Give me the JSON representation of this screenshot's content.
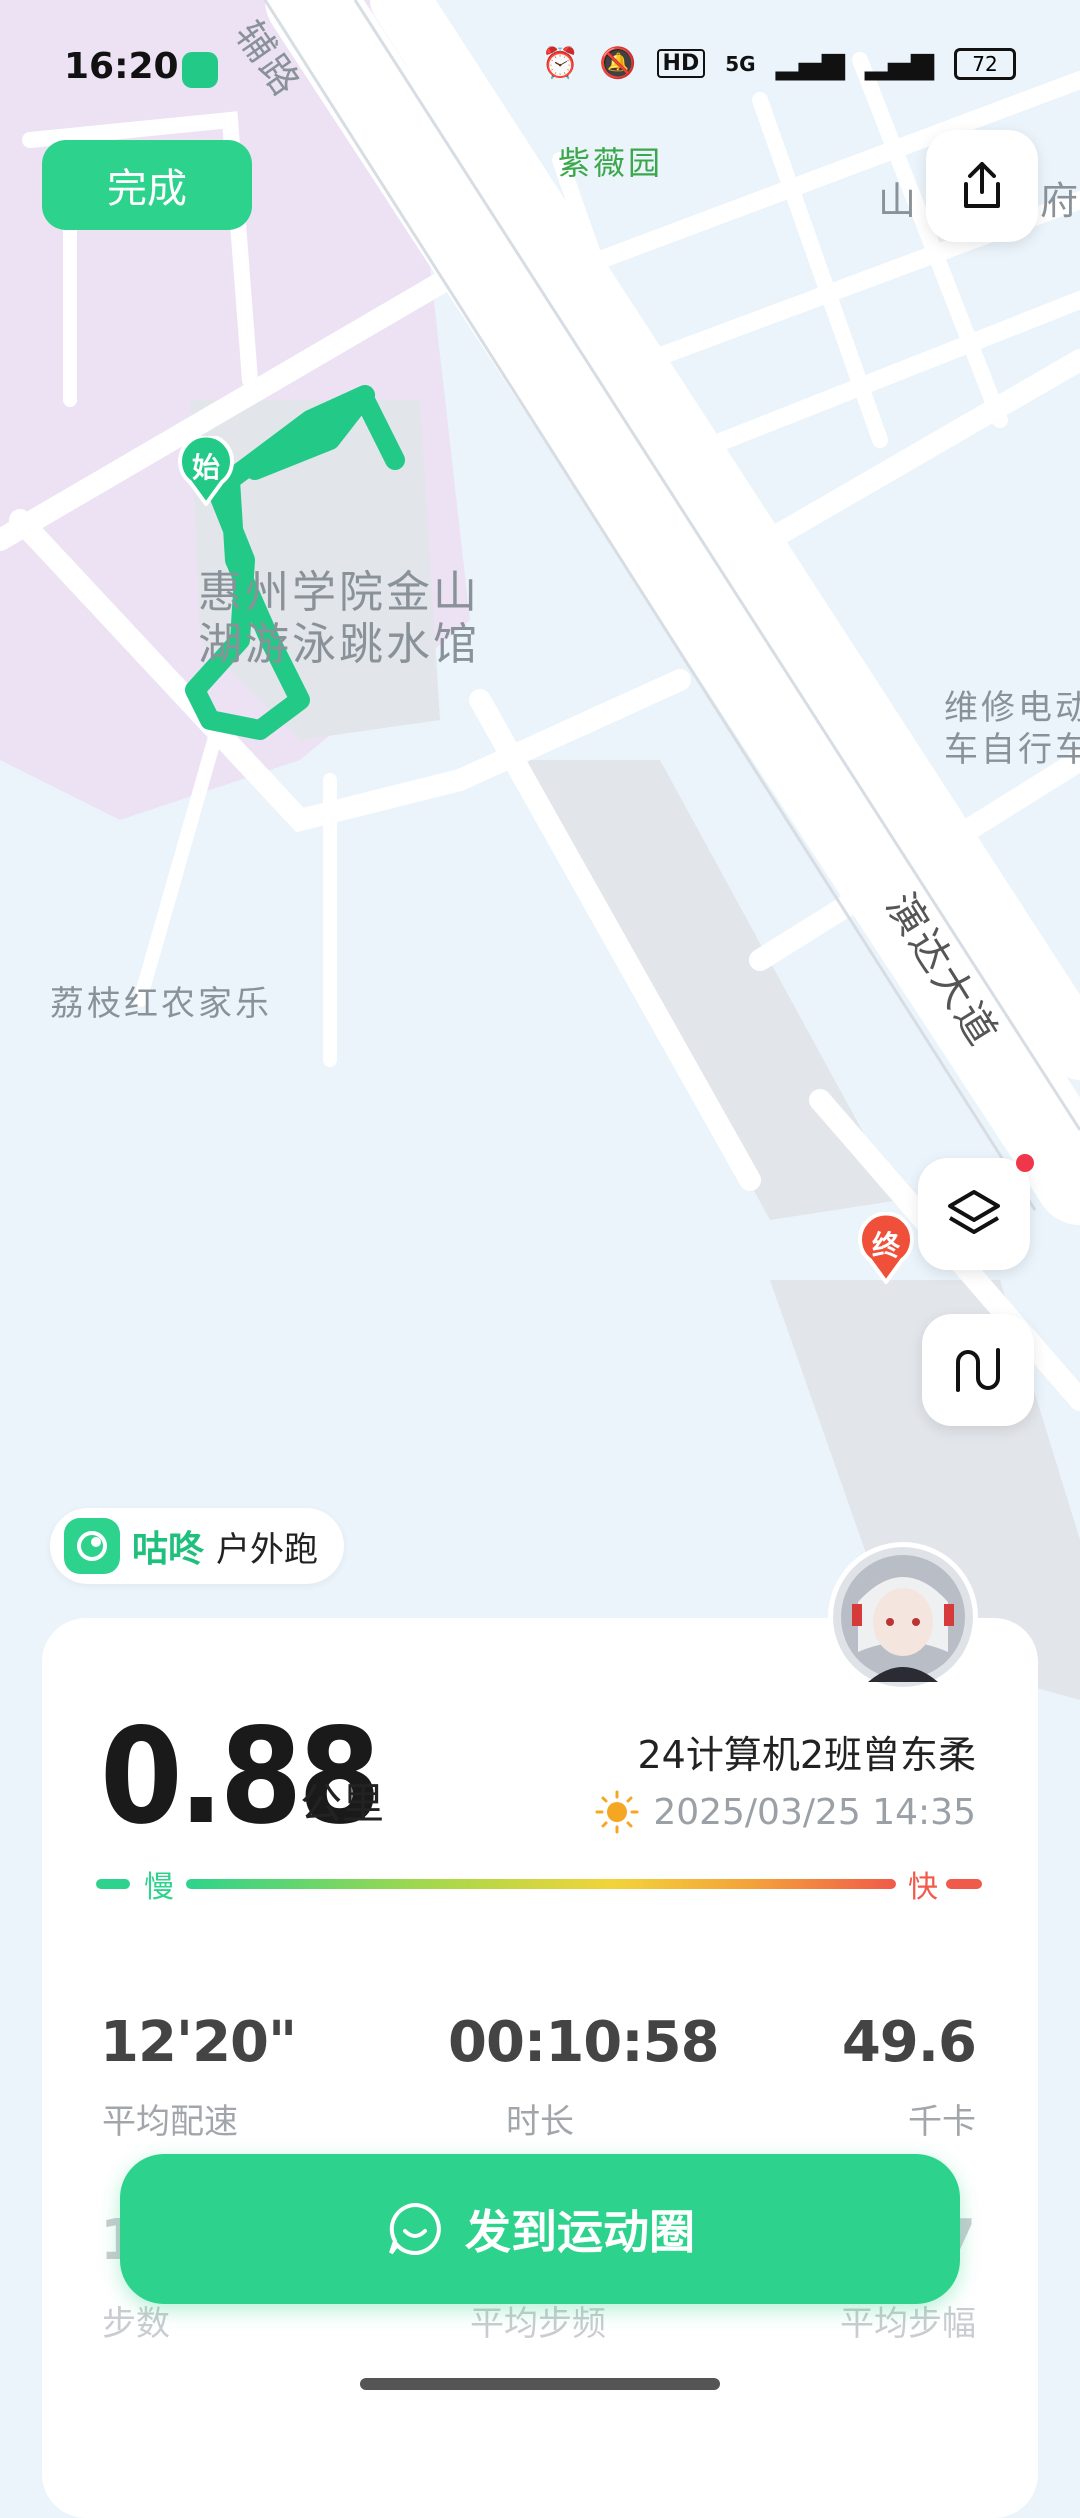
{
  "status_bar": {
    "time": "16:20",
    "network": "5G",
    "battery": "72"
  },
  "top": {
    "done_label": "完成"
  },
  "map": {
    "labels": {
      "fudao": "辅路",
      "ziweiyuan": "紫薇园",
      "shan": "山",
      "fu": "府",
      "venue_line1": "惠州学院金山",
      "venue_line2": "湖游泳跳水馆",
      "weixiu_line1": "维修电动",
      "weixiu_line2": "车自行车",
      "yanda_road": "演达大道",
      "lizhi": "荔枝红农家乐"
    },
    "start_marker": "始",
    "end_marker": "终"
  },
  "brand": {
    "name": "咕咚",
    "activity": "户外跑"
  },
  "summary": {
    "distance": "0.88",
    "distance_unit": "公里",
    "user_name": "24计算机2班曾东柔",
    "datetime": "2025/03/25 14:35",
    "pace_slow_label": "慢",
    "pace_fast_label": "快"
  },
  "stats": [
    {
      "value": "12'20\"",
      "label": "平均配速"
    },
    {
      "value": "00:10:58",
      "label": "时长"
    },
    {
      "value": "49.6",
      "label": "千卡"
    }
  ],
  "stats_row2": [
    {
      "value": "1",
      "label": "步数"
    },
    {
      "value": "",
      "label": "平均步频"
    },
    {
      "value": "7",
      "label": "平均步幅"
    }
  ],
  "cta": {
    "label": "发到运动圈"
  },
  "colors": {
    "accent": "#2dd38c",
    "route": "#22c987",
    "end_pin": "#f0503a"
  }
}
